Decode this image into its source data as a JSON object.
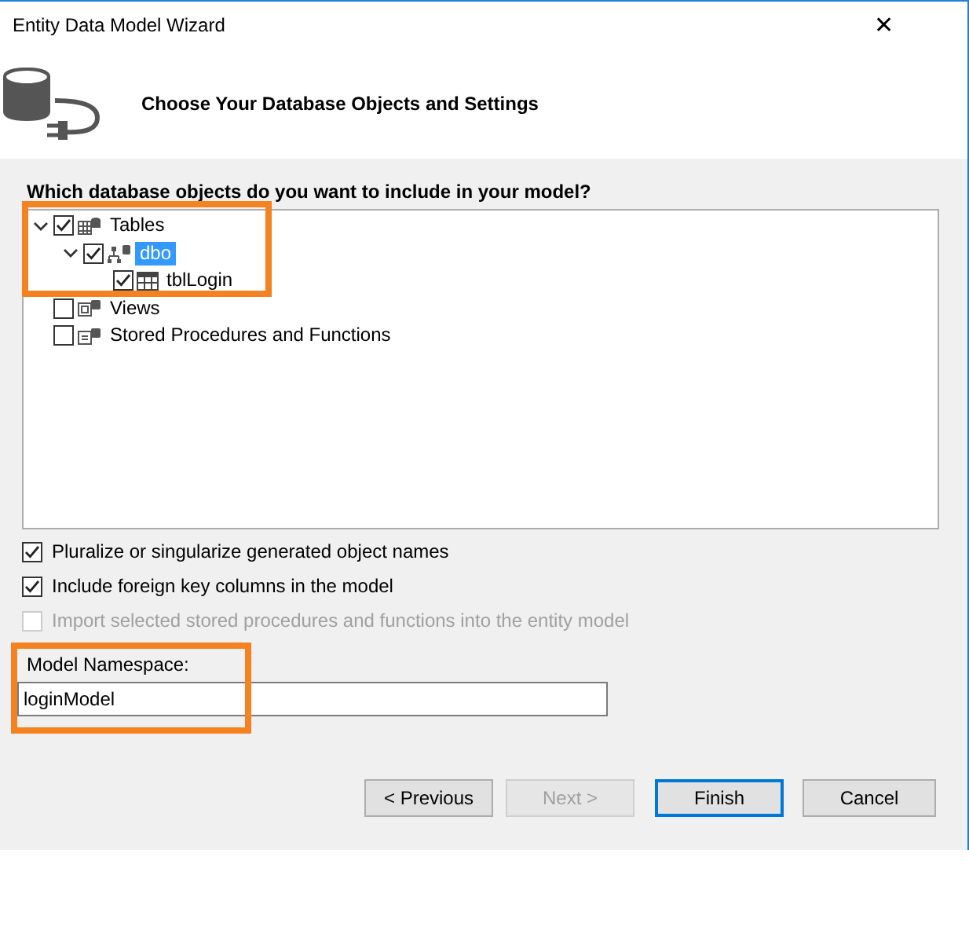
{
  "window": {
    "title": "Entity Data Model Wizard",
    "close": "✕"
  },
  "header": {
    "title": "Choose Your Database Objects and Settings"
  },
  "tree_label": "Which database objects do you want to include in your model?",
  "tree": [
    {
      "label": "Tables",
      "kind": "tables",
      "checked": true,
      "expanded": true,
      "selected": false,
      "children": [
        {
          "label": "dbo",
          "kind": "schema",
          "checked": true,
          "expanded": true,
          "selected": true,
          "children": [
            {
              "label": "tblLogin",
              "kind": "table",
              "checked": true,
              "selected": false
            }
          ]
        }
      ]
    },
    {
      "label": "Views",
      "kind": "views",
      "checked": false,
      "selected": false
    },
    {
      "label": "Stored Procedures and Functions",
      "kind": "procedures",
      "checked": false,
      "selected": false
    }
  ],
  "options": [
    {
      "label": "Pluralize or singularize generated object names",
      "checked": true,
      "disabled": false
    },
    {
      "label": "Include foreign key columns in the model",
      "checked": true,
      "disabled": false
    },
    {
      "label": "Import selected stored procedures and functions into the entity model",
      "checked": false,
      "disabled": true
    }
  ],
  "namespace": {
    "label": "Model Namespace:",
    "value": "loginModel"
  },
  "buttons": [
    {
      "label": "< Previous",
      "disabled": false,
      "default": false
    },
    {
      "label": "Next >",
      "disabled": true,
      "default": false
    },
    {
      "label": "Finish",
      "disabled": false,
      "default": true
    },
    {
      "label": "Cancel",
      "disabled": false,
      "default": false
    }
  ]
}
